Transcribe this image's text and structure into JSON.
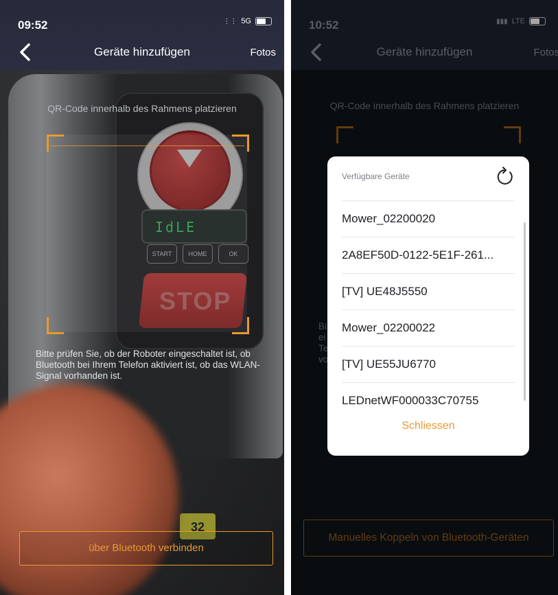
{
  "left": {
    "status": {
      "time": "09:52",
      "network": "5G"
    },
    "nav": {
      "title": "Geräte hinzufügen",
      "right": "Fotos"
    },
    "hint": "QR-Code innerhalb des Rahmens platzieren",
    "info": "Bitte prüfen Sie, ob der Roboter eingeschaltet ist, ob Bluetooth bei Ihrem Telefon aktiviert ist, ob das WLAN-Signal vorhanden ist.",
    "lcd": "IdLE",
    "buttons": [
      "START",
      "HOME",
      "OK"
    ],
    "stop_label": "STOP",
    "sticker": "32",
    "bluetooth_button": "über Bluetooth verbinden"
  },
  "right": {
    "status": {
      "time": "10:52",
      "network": "LTE"
    },
    "nav": {
      "title": "Geräte hinzufügen",
      "right": "Fotos"
    },
    "hint": "QR-Code innerhalb des Rahmens platzieren",
    "info": "Bi ei Te vo",
    "manual_button": "Manuelles Koppeln von Bluetooth-Geräten",
    "dialog": {
      "title": "Verfügbare Geräte",
      "devices": [
        "Mower_02200020",
        "2A8EF50D-0122-5E1F-261...",
        "[TV] UE48J5550",
        "Mower_02200022",
        "[TV] UE55JU6770",
        "LEDnetWF000033C70755"
      ],
      "close": "Schliessen"
    }
  },
  "colors": {
    "accent": "#e89a2f",
    "nav_bg": "#262a3a"
  },
  "icons": {
    "back": "chevron-left-icon",
    "refresh": "refresh-icon",
    "battery": "battery-icon"
  }
}
